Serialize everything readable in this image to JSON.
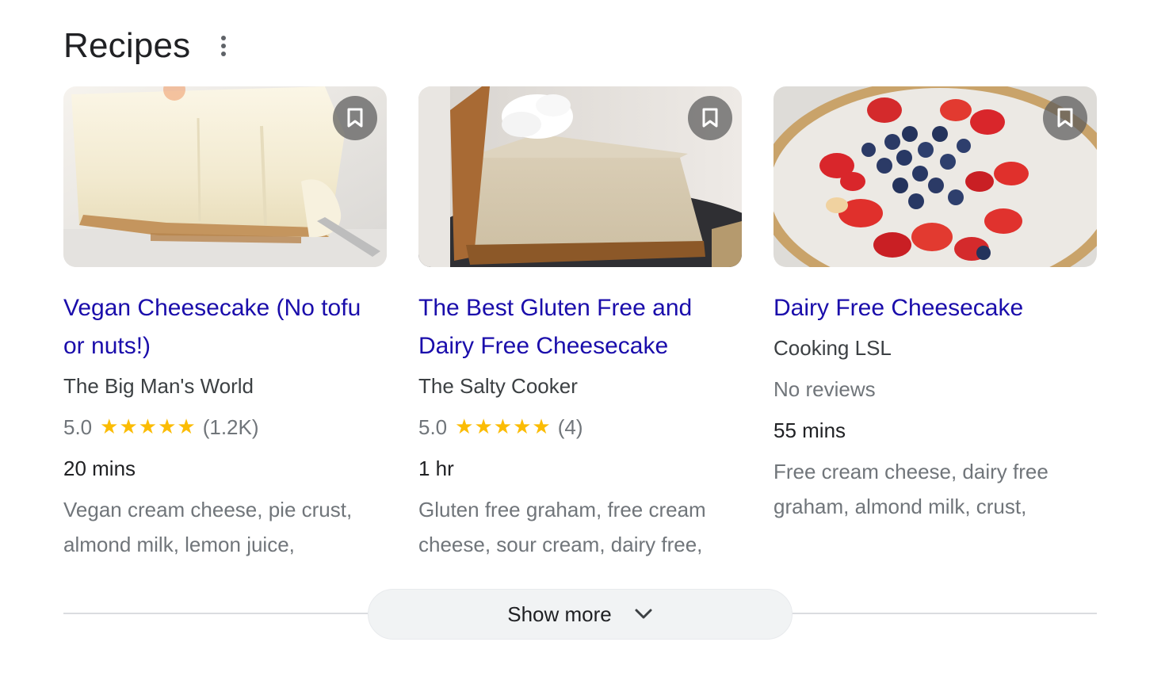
{
  "section": {
    "title": "Recipes",
    "menu_icon": "more-vert-icon"
  },
  "cards": [
    {
      "title": "Vegan Cheesecake (No tofu or nuts!)",
      "source": "The Big Man's World",
      "rating": "5.0",
      "stars": 5,
      "review_count": "(1.2K)",
      "time": "20 mins",
      "ingredients": "Vegan cream cheese, pie crust, almond milk, lemon juice,",
      "image_icon": "cheesecake-photo",
      "bookmark_icon": "bookmark-icon"
    },
    {
      "title": "The Best Gluten Free and Dairy Free Cheesecake",
      "source": "The Salty Cooker",
      "rating": "5.0",
      "stars": 5,
      "review_count": "(4)",
      "time": "1 hr",
      "ingredients": "Gluten free graham, free cream cheese, sour cream, dairy free,",
      "image_icon": "cheesecake-slice-photo",
      "bookmark_icon": "bookmark-icon"
    },
    {
      "title": "Dairy Free Cheesecake",
      "source": "Cooking LSL",
      "reviews": "No reviews",
      "time": "55 mins",
      "ingredients": "Free cream cheese, dairy free graham, almond milk, crust,",
      "image_icon": "berry-cheesecake-photo",
      "bookmark_icon": "bookmark-icon"
    }
  ],
  "show_more": {
    "label": "Show more",
    "icon": "chevron-down-icon"
  },
  "colors": {
    "link": "#1a0dab",
    "star": "#fbbc04",
    "muted": "#70757a",
    "text": "#202124"
  }
}
